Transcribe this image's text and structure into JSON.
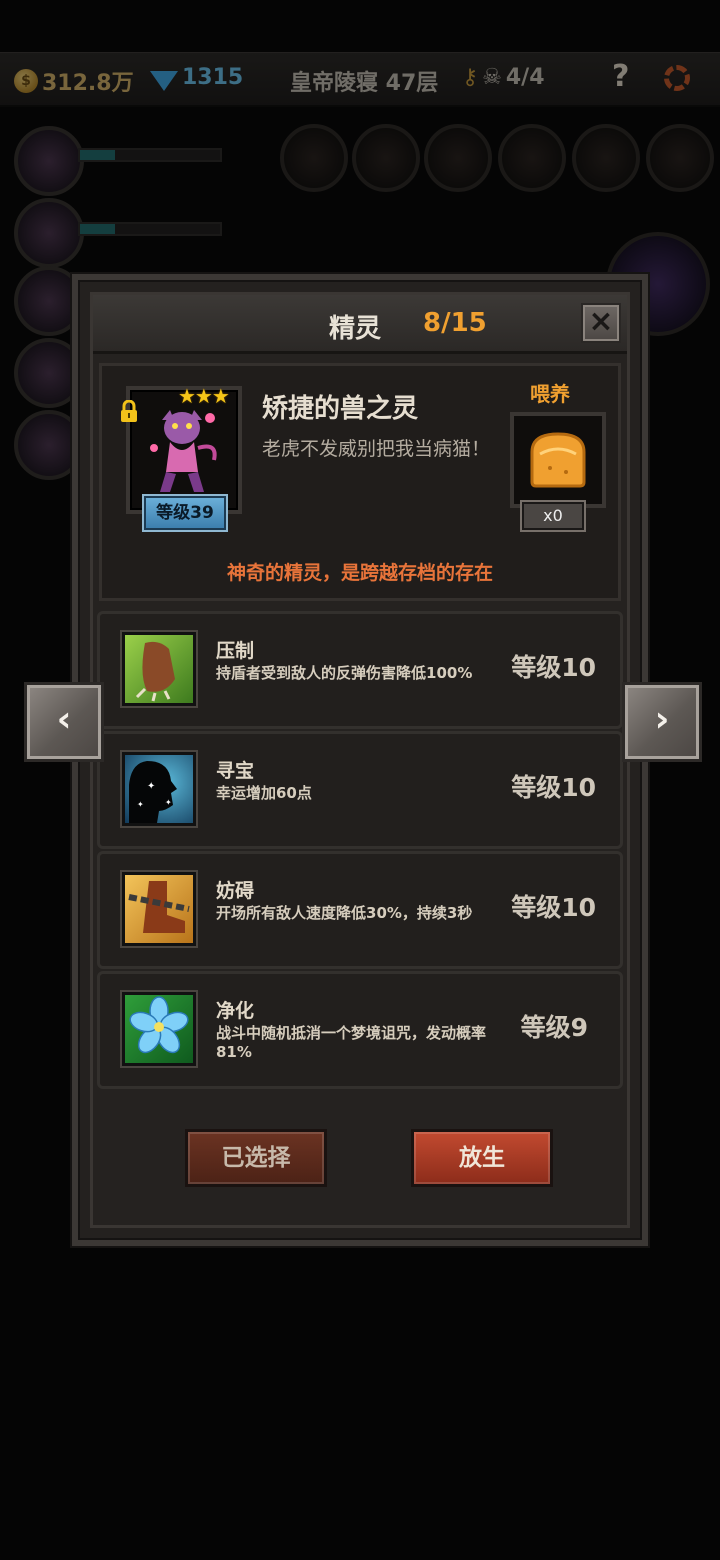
{
  "hud": {
    "gold": "312.8万",
    "gems": "1315",
    "location": "皇帝陵寝 47层",
    "keys": "4/4",
    "help": "?"
  },
  "panel": {
    "title": "精灵",
    "count": "8/15",
    "close": "×"
  },
  "spirit": {
    "stars": "★★★",
    "level": "等级39",
    "name": "矫捷的兽之灵",
    "description": "老虎不发威别把我当病猫！",
    "feed_label": "喂养",
    "feed_count": "x0",
    "tagline": "神奇的精灵，是跨越存档的存在"
  },
  "skills": [
    {
      "name": "压制",
      "desc": "持盾者受到敌人的反弹伤害降低100%",
      "level": "等级10",
      "icon": "beast-claw-icon"
    },
    {
      "name": "寻宝",
      "desc": "幸运增加60点",
      "level": "等级10",
      "icon": "sparkle-silhouette-icon"
    },
    {
      "name": "妨碍",
      "desc": "开场所有敌人速度降低30%，持续3秒",
      "level": "等级10",
      "icon": "chained-boot-icon"
    },
    {
      "name": "净化",
      "desc": "战斗中随机抵消一个梦境诅咒，发动概率81%",
      "level": "等级9",
      "icon": "blue-flower-icon"
    }
  ],
  "buttons": {
    "selected": "已选择",
    "release": "放生"
  },
  "nav": {
    "prev": "‹",
    "next": "›"
  },
  "colors": {
    "accent_orange": "#f0a030",
    "tagline": "#e8743a",
    "level_badge": "#4a8dbf",
    "release_button": "#a83a24"
  }
}
